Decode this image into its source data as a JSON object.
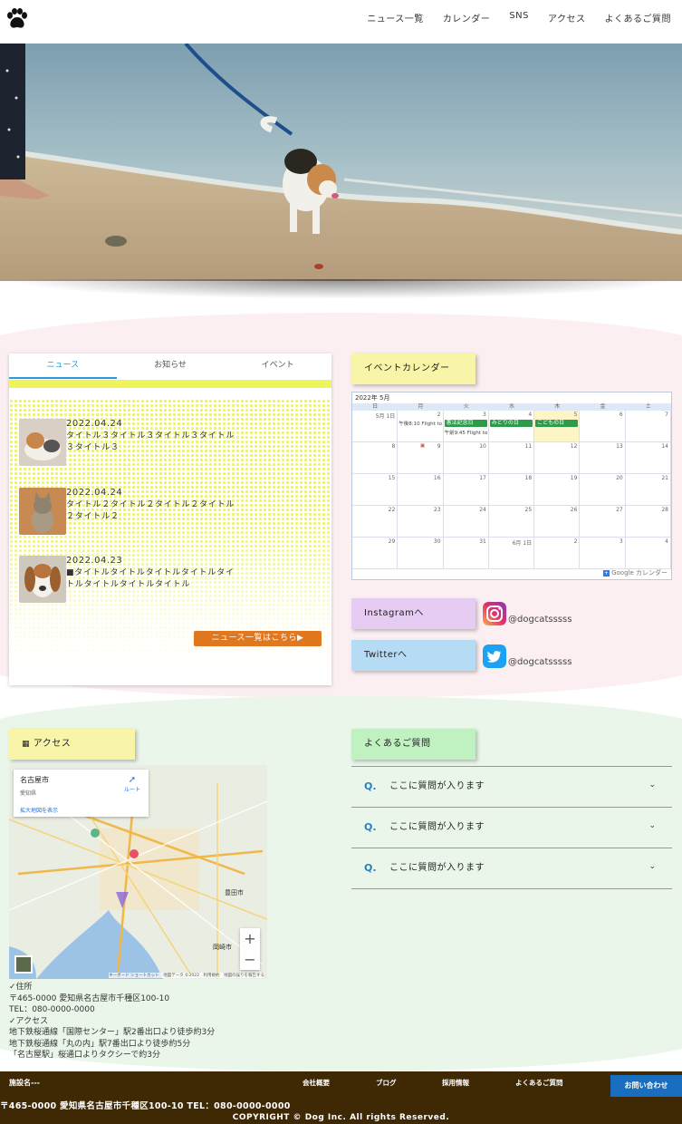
{
  "header": {
    "logo": "paw-icon",
    "nav": [
      "ニュース一覧",
      "カレンダー",
      "SNS",
      "アクセス",
      "よくあるご質問"
    ]
  },
  "news": {
    "tabs": [
      "ニュース",
      "お知らせ",
      "イベント"
    ],
    "items": [
      {
        "date": "2022.04.24",
        "title": "タイトル３タイトル３タイトル３タイトル３タイトル３"
      },
      {
        "date": "2022.04.24",
        "title": "タイトル２タイトル２タイトル２タイトル２タイトル２"
      },
      {
        "date": "2022.04.23",
        "title": "■タイトルタイトルタイトルタイトルタイトルタイトルタイトルタイトル"
      }
    ],
    "more_label": "ニュース一覧はこちら▶"
  },
  "calendar": {
    "label": "イベントカレンダー",
    "month": "2022年 5月",
    "weekdays": [
      "日",
      "月",
      "火",
      "水",
      "木",
      "金",
      "土"
    ],
    "weeks": [
      [
        "5月 1日",
        "2",
        "3",
        "4",
        "5",
        "6",
        "7"
      ],
      [
        "8",
        "9",
        "10",
        "11",
        "12",
        "13",
        "14"
      ],
      [
        "15",
        "16",
        "17",
        "18",
        "19",
        "20",
        "21"
      ],
      [
        "22",
        "23",
        "24",
        "25",
        "26",
        "27",
        "28"
      ],
      [
        "29",
        "30",
        "31",
        "6月 1日",
        "2",
        "3",
        "4"
      ]
    ],
    "events": {
      "flight1": "午後8:10 Flight to",
      "flight2": "午前9:45 Flight to",
      "holiday1": "憲法記念日",
      "holiday2": "みどりの日",
      "holiday3": "こどもの日"
    },
    "footer": "Google カレンダー"
  },
  "sns": {
    "instagram_label": "Instagramへ",
    "instagram_handle": "@dogcatsssss",
    "twitter_label": "Twitterへ",
    "twitter_handle": "@dogcatsssss"
  },
  "access": {
    "label": "アクセス",
    "map_place": "名古屋市",
    "map_pref": "愛知県",
    "map_route": "ルート",
    "map_enlarge": "拡大地図を表示",
    "map_city1": "豊田市",
    "map_city2": "岡崎市",
    "map_attrib": "キーボード ショートカット　地図データ ©2022　利用規約　地図の誤りを報告する",
    "lines": [
      "✓住所",
      "〒465-0000 愛知県名古屋市千種区100-10",
      "TEL：080-0000-0000",
      "✓アクセス",
      "地下鉄桜通線「国際センター」駅2番出口より徒歩約3分",
      "地下鉄桜通線「丸の内」駅7番出口より徒歩約5分",
      "「名古屋駅」桜通口よりタクシーで約3分"
    ]
  },
  "faq": {
    "label": "よくあるご質問",
    "q_mark": "Q.",
    "items": [
      "ここに質問が入ります",
      "ここに質問が入ります",
      "ここに質問が入ります"
    ]
  },
  "footer": {
    "name": "施設名---",
    "links": [
      "会社概要",
      "ブログ",
      "採用情報",
      "よくあるご質問"
    ],
    "contact": "お問い合わせ",
    "address": "〒465-0000 愛知県名古屋市千種区100-10 TEL：080-0000-0000",
    "copyright": "COPYRIGHT © Dog Inc. All rights Reserved."
  },
  "colors": {
    "accent_blue": "#2a9ad0",
    "news_button": "#e07820",
    "pink_section": "#fbeff1",
    "green_section": "#eaf6ea",
    "footer_bg": "#3f2804",
    "contact_button": "#1a6ec0"
  }
}
